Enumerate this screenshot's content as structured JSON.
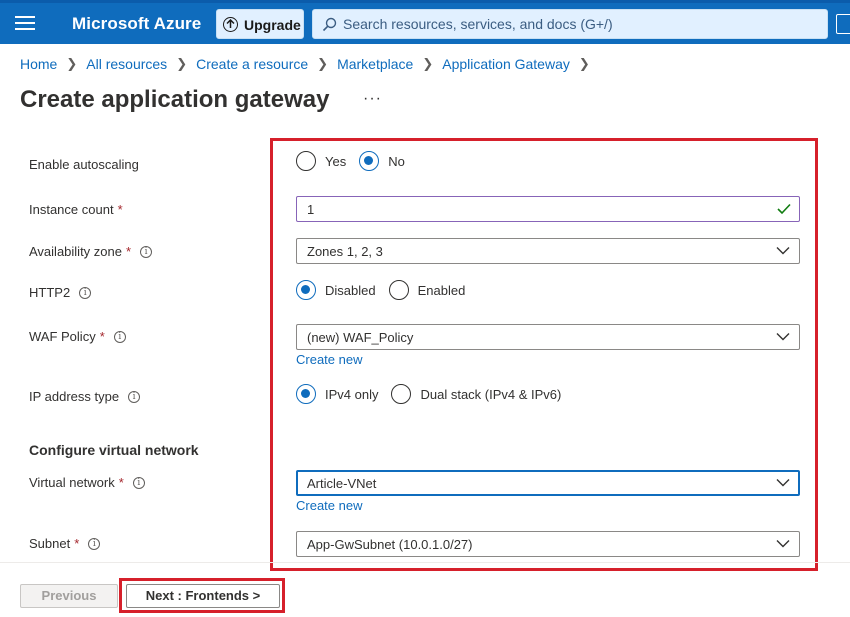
{
  "topbar": {
    "brand": "Microsoft Azure",
    "upgrade_label": "Upgrade",
    "search_placeholder": "Search resources, services, and docs (G+/)"
  },
  "breadcrumb": [
    "Home",
    "All resources",
    "Create a resource",
    "Marketplace",
    "Application Gateway"
  ],
  "page": {
    "title": "Create application gateway",
    "more": "···"
  },
  "form": {
    "autoscaling": {
      "label": "Enable autoscaling",
      "options": [
        "Yes",
        "No"
      ],
      "selected": "No"
    },
    "instance_count": {
      "label": "Instance count",
      "required": "*",
      "value": "1"
    },
    "availability_zone": {
      "label": "Availability zone",
      "required": "*",
      "value": "Zones 1, 2, 3"
    },
    "http2": {
      "label": "HTTP2",
      "options": [
        "Disabled",
        "Enabled"
      ],
      "selected": "Disabled"
    },
    "waf_policy": {
      "label": "WAF Policy",
      "required": "*",
      "value": "(new) WAF_Policy",
      "create_new": "Create new"
    },
    "ip_type": {
      "label": "IP address type",
      "options": [
        "IPv4 only",
        "Dual stack (IPv4 & IPv6)"
      ],
      "selected": "IPv4 only"
    },
    "vnet_section": "Configure virtual network",
    "virtual_network": {
      "label": "Virtual network",
      "required": "*",
      "value": "Article-VNet",
      "create_new": "Create new"
    },
    "subnet": {
      "label": "Subnet",
      "required": "*",
      "value": "App-GwSubnet (10.0.1.0/27)"
    }
  },
  "footer": {
    "previous": "Previous",
    "next": "Next : Frontends >"
  },
  "colors": {
    "accent": "#0f6cbd",
    "highlight": "#d6202b",
    "valid_check": "#107c10"
  }
}
